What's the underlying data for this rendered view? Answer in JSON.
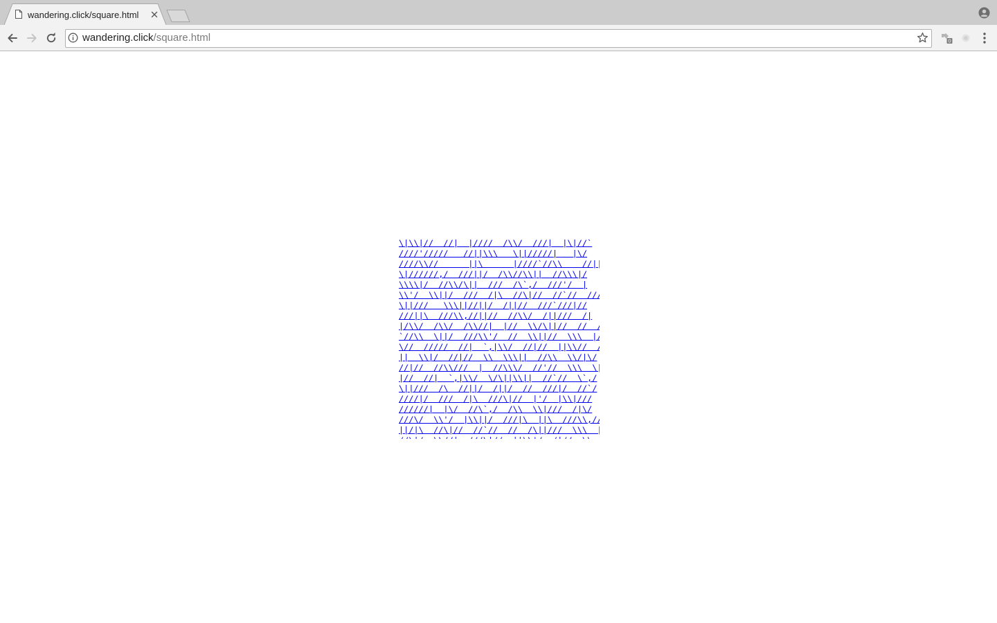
{
  "browser": {
    "tab": {
      "title": "wandering.click/square.html",
      "favicon": "page-icon",
      "close_icon": "close-icon"
    },
    "new_tab_icon": "new-tab-icon",
    "profile_icon": "profile-icon",
    "toolbar": {
      "back_icon": "back-arrow-icon",
      "forward_icon": "forward-arrow-icon",
      "reload_icon": "reload-icon",
      "site_info_icon": "info-icon",
      "url_host": "wandering.click",
      "url_path": "/square.html",
      "bookmark_icon": "star-icon",
      "extension_badge": "0",
      "extension_icons": [
        "puzzle-badge-icon",
        "disabled-extension-icon"
      ],
      "menu_icon": "kebab-menu-icon"
    },
    "colors": {
      "tabstrip": "#cccccc",
      "toolbar": "#f2f2f2",
      "link": "#0000ee"
    }
  },
  "page": {
    "square_lines": [
      "\\|\\\\|//  //|  |////  /\\\\/  ///|  |\\|//`",
      "////'/////   //||\\\\\\   \\||/////|   |\\/",
      "////\\\\//      ||\\      |////`//\\\\    //||",
      "\\|//////,/  ///||/  /\\\\//\\\\||  //\\\\\\|/",
      "\\\\\\\\|/  //\\\\/\\||  ///  /\\`,/  ///'/  |",
      "\\\\'/  \\\\||/  ///  /|\\  //\\|//  //`//  ///",
      "\\||///   \\\\\\||//||/  /||//  ///`///|//",
      "///||\\  ///\\\\,//||//  //\\\\/  /||///  /|",
      "|/\\\\/  /\\\\/  /\\\\//|  |//  \\\\/\\||//  //  /",
      "`//\\\\  \\||/  ///\\\\'/  //  \\\\||//  \\\\\\  |/",
      "\\//  /////  //|  `,|\\\\/  //|//  ||\\\\//  //",
      "||  \\\\|/  //|//  \\\\  \\\\\\||  //\\\\  \\\\/|\\/",
      "//|//  //\\\\///  |  //\\\\\\/  //'//  \\\\\\  \\|",
      "|//  //|  `,|\\\\/  \\/\\||\\\\||  //`//  \\`,/",
      "\\||///  /\\  //||/  /||/  //  ///|/  //`/",
      "////|/  ///  /|\\  ///\\|//  |'/  |\\\\|///",
      "//////|  |\\/  //\\`,/  /\\\\  \\\\|///  /|\\/",
      "///\\/  \\\\'/  |\\\\||/  ///|\\  ||\\  ///\\\\,//",
      "||/|\\  //\\|//  //`//  //  /\\||///  \\\\\\  |",
      "//\\|/  \\\\//|  ///\\|//  ||\\\\'/  /|//  \\\\"
    ]
  }
}
